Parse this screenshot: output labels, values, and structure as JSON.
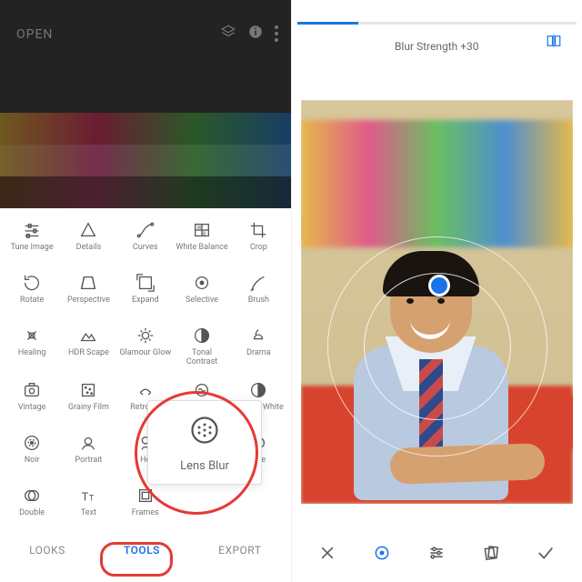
{
  "left": {
    "open_label": "OPEN",
    "bottom_nav": {
      "looks": "LOOKS",
      "tools": "TOOLS",
      "export": "EXPORT"
    },
    "lens_popup_label": "Lens Blur",
    "tools": [
      {
        "id": "tune-image",
        "label": "Tune Image"
      },
      {
        "id": "details",
        "label": "Details"
      },
      {
        "id": "curves",
        "label": "Curves"
      },
      {
        "id": "white-balance",
        "label": "White Balance"
      },
      {
        "id": "crop",
        "label": "Crop"
      },
      {
        "id": "rotate",
        "label": "Rotate"
      },
      {
        "id": "perspective",
        "label": "Perspective"
      },
      {
        "id": "expand",
        "label": "Expand"
      },
      {
        "id": "selective",
        "label": "Selective"
      },
      {
        "id": "brush",
        "label": "Brush"
      },
      {
        "id": "healing",
        "label": "Healing"
      },
      {
        "id": "hdr-scape",
        "label": "HDR Scape"
      },
      {
        "id": "glamour-glow",
        "label": "Glamour Glow"
      },
      {
        "id": "tonal-contrast",
        "label": "Tonal Contrast"
      },
      {
        "id": "drama",
        "label": "Drama"
      },
      {
        "id": "vintage",
        "label": "Vintage"
      },
      {
        "id": "grainy-film",
        "label": "Grainy Film"
      },
      {
        "id": "retrolux",
        "label": "Retrolux"
      },
      {
        "id": "grunge",
        "label": ""
      },
      {
        "id": "black-white",
        "label": "Black & White"
      },
      {
        "id": "noir",
        "label": "Noir"
      },
      {
        "id": "portrait",
        "label": "Portrait"
      },
      {
        "id": "head-pose",
        "label": "He"
      },
      {
        "id": "lens-blur",
        "label": ""
      },
      {
        "id": "vignette",
        "label": "ette"
      },
      {
        "id": "double-exposure",
        "label": "Double"
      },
      {
        "id": "text",
        "label": "Text"
      },
      {
        "id": "frames",
        "label": "Frames"
      }
    ]
  },
  "right": {
    "status_label": "Blur Strength +30",
    "progress_percent": 22
  }
}
